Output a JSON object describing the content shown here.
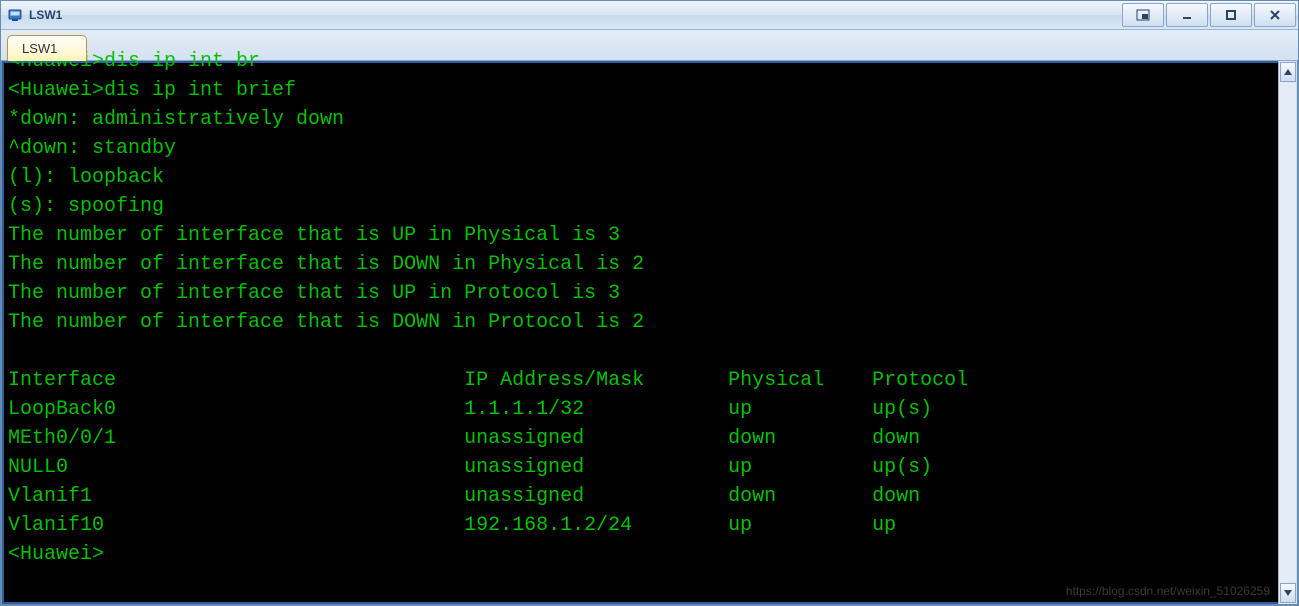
{
  "window": {
    "title": "LSW1"
  },
  "tabs": [
    {
      "label": "LSW1"
    }
  ],
  "terminal": {
    "col_iface": 38,
    "col_ip": 22,
    "col_phys": 12,
    "lines_top": [
      "<Huawei>dis ip int br",
      "<Huawei>dis ip int brief",
      "*down: administratively down",
      "^down: standby",
      "(l): loopback",
      "(s): spoofing",
      "The number of interface that is UP in Physical is 3",
      "The number of interface that is DOWN in Physical is 2",
      "The number of interface that is UP in Protocol is 3",
      "The number of interface that is DOWN in Protocol is 2",
      ""
    ],
    "table_header": [
      "Interface",
      "IP Address/Mask",
      "Physical",
      "Protocol"
    ],
    "table_rows": [
      [
        "LoopBack0",
        "1.1.1.1/32",
        "up",
        "up(s)"
      ],
      [
        "MEth0/0/1",
        "unassigned",
        "down",
        "down"
      ],
      [
        "NULL0",
        "unassigned",
        "up",
        "up(s)"
      ],
      [
        "Vlanif1",
        "unassigned",
        "down",
        "down"
      ],
      [
        "Vlanif10",
        "192.168.1.2/24",
        "up",
        "up"
      ]
    ],
    "prompt_after": "<Huawei>"
  },
  "watermark": "https://blog.csdn.net/weixin_51026259"
}
